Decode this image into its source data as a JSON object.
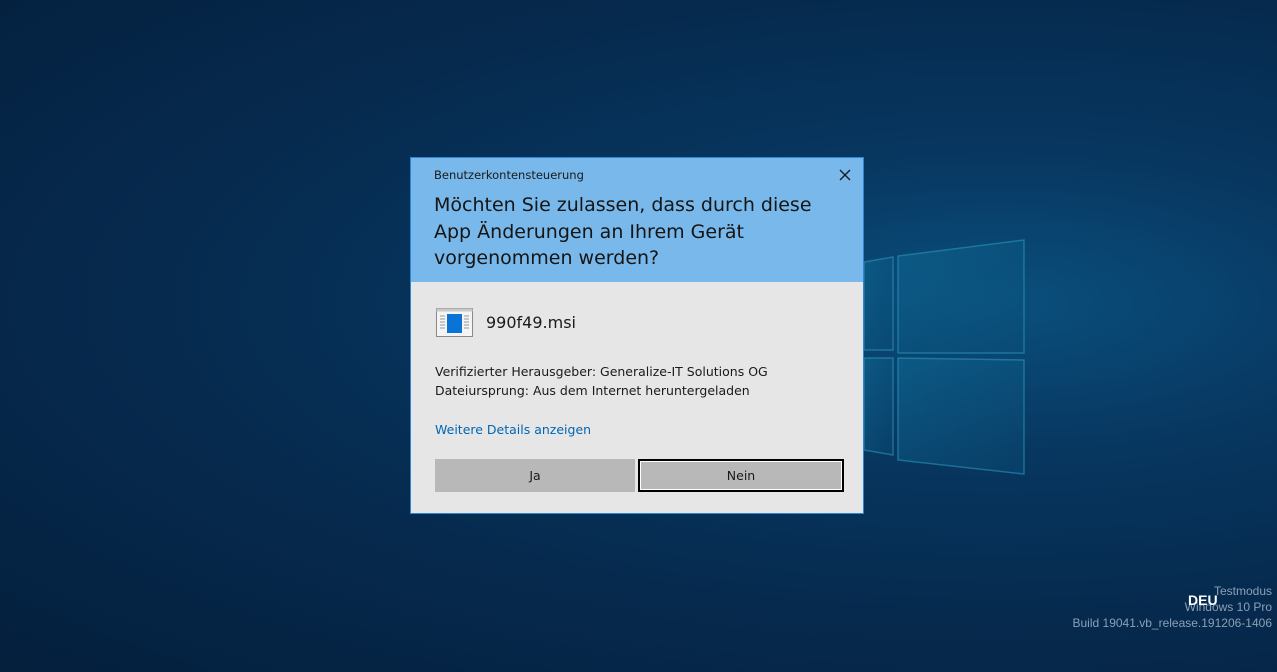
{
  "dialog": {
    "caption": "Benutzerkontensteuerung",
    "question": "Möchten Sie zulassen, dass durch diese App Änderungen an Ihrem Gerät vorgenommen werden?",
    "app_name": "990f49.msi",
    "publisher_line": "Verifizierter Herausgeber: Generalize-IT Solutions OG",
    "origin_line": "Dateiursprung: Aus dem Internet heruntergeladen",
    "details_link": "Weitere Details anzeigen",
    "yes_button": "Ja",
    "no_button": "Nein"
  },
  "watermark": {
    "mode": "Testmodus",
    "edition": "Windows 10 Pro",
    "build": "Build 19041.vb_release.191206-1406"
  },
  "language_indicator": "DEU",
  "colors": {
    "header": "#78b8ea",
    "body": "#e6e6e6",
    "link": "#0066b4",
    "button": "#b8b8b8",
    "border": "#2b86d6"
  },
  "icons": {
    "close": "close-icon",
    "app": "installer-app-icon",
    "desktop_logo": "windows-logo-icon"
  }
}
